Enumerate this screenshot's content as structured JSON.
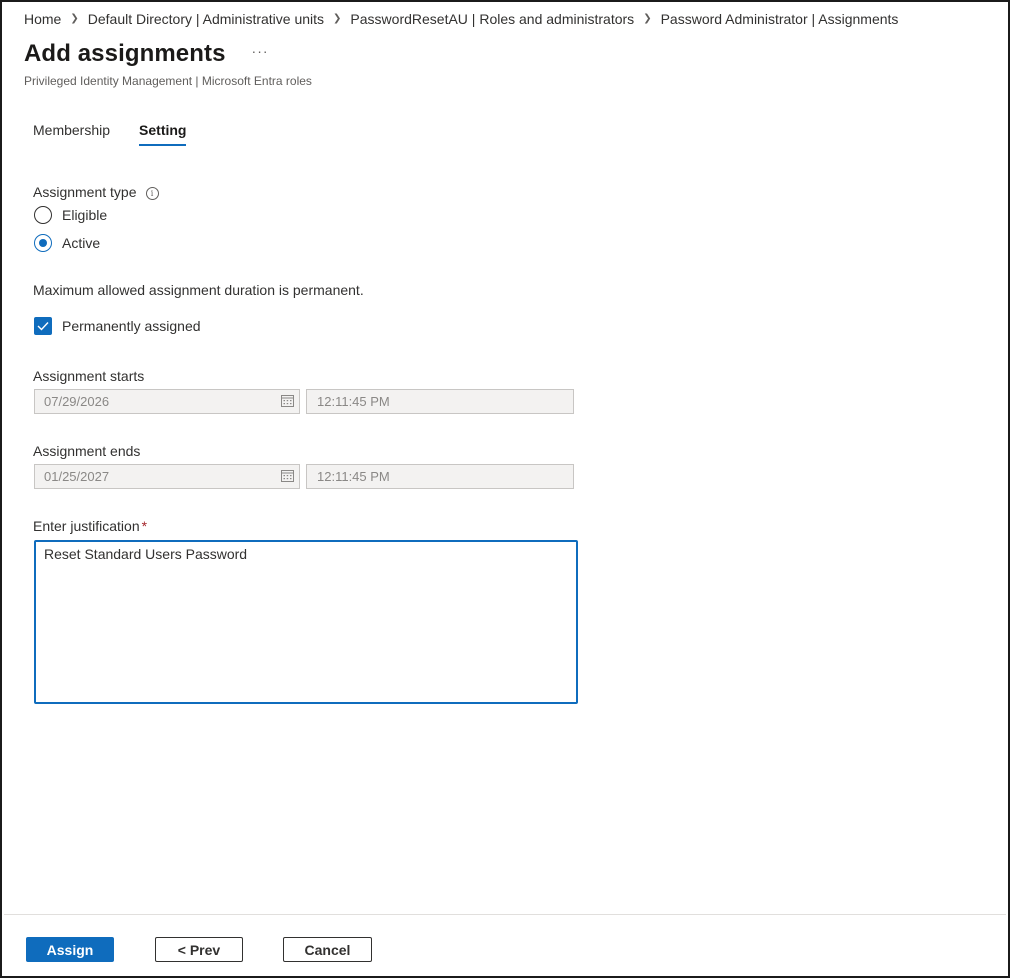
{
  "breadcrumb": [
    "Home",
    "Default Directory | Administrative units",
    "PasswordResetAU | Roles and administrators",
    "Password Administrator | Assignments"
  ],
  "header": {
    "title": "Add assignments",
    "more": "···",
    "subtitle": "Privileged Identity Management | Microsoft Entra roles"
  },
  "tabs": [
    {
      "label": "Membership",
      "active": false
    },
    {
      "label": "Setting",
      "active": true
    }
  ],
  "assignment_type": {
    "label": "Assignment type",
    "info_icon": "info-icon",
    "options": [
      {
        "label": "Eligible",
        "selected": false
      },
      {
        "label": "Active",
        "selected": true
      }
    ]
  },
  "duration_note": "Maximum allowed assignment duration is permanent.",
  "permanent": {
    "label": "Permanently assigned",
    "checked": true
  },
  "start": {
    "label": "Assignment starts",
    "date": "07/29/2026",
    "time": "12:11:45 PM"
  },
  "end": {
    "label": "Assignment ends",
    "date": "01/25/2027",
    "time": "12:11:45 PM"
  },
  "justification": {
    "label": "Enter justification",
    "required_mark": "*",
    "value": "Reset Standard Users Password"
  },
  "footer": {
    "assign": "Assign",
    "prev": "< Prev",
    "cancel": "Cancel"
  },
  "colors": {
    "accent": "#0f6cbd",
    "required": "#a4262c"
  }
}
